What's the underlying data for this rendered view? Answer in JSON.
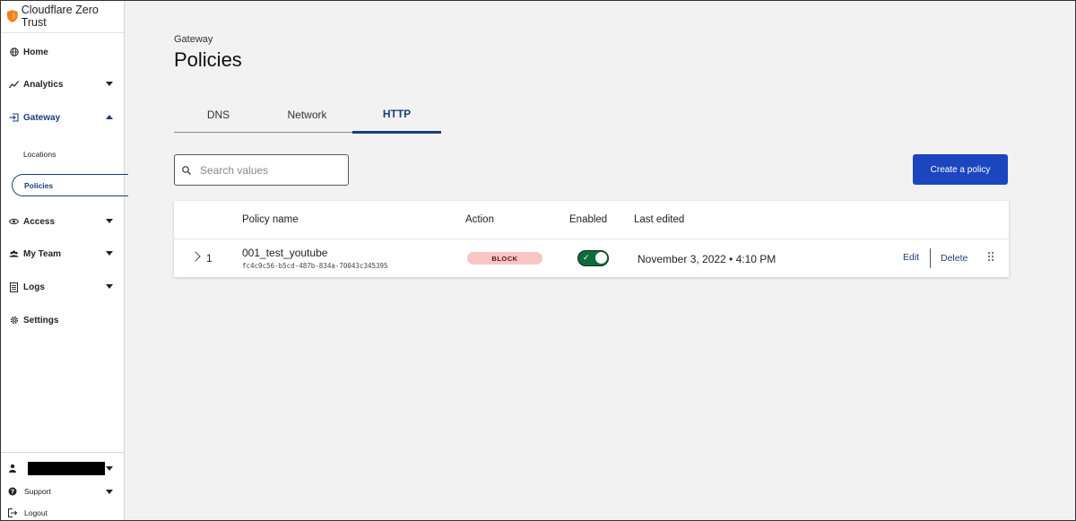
{
  "brand": {
    "name": "Cloudflare Zero Trust"
  },
  "sidebar": {
    "items": [
      {
        "label": "Home",
        "icon": "globe-icon"
      },
      {
        "label": "Analytics",
        "icon": "analytics-icon"
      },
      {
        "label": "Gateway",
        "icon": "gateway-icon"
      },
      {
        "label": "Access",
        "icon": "access-icon"
      },
      {
        "label": "My Team",
        "icon": "team-icon"
      },
      {
        "label": "Logs",
        "icon": "logs-icon"
      },
      {
        "label": "Settings",
        "icon": "gear-icon"
      }
    ],
    "gateway_sub": [
      {
        "label": "Locations"
      },
      {
        "label": "Policies"
      }
    ],
    "bottom": {
      "support": "Support",
      "logout": "Logout"
    }
  },
  "header": {
    "breadcrumb": "Gateway",
    "title": "Policies"
  },
  "tabs": [
    {
      "label": "DNS"
    },
    {
      "label": "Network"
    },
    {
      "label": "HTTP"
    }
  ],
  "search": {
    "placeholder": "Search values"
  },
  "actions": {
    "create_label": "Create a policy"
  },
  "table": {
    "headers": [
      "Policy name",
      "Action",
      "Enabled",
      "Last edited"
    ],
    "rows": [
      {
        "order": "1",
        "name": "001_test_youtube",
        "id": "fc4c9c56-b5cd-487b-834a-70043c345395",
        "action": "BLOCK",
        "enabled": true,
        "last_edited": "November 3, 2022 • 4:10 PM",
        "edit_label": "Edit",
        "delete_label": "Delete"
      }
    ]
  },
  "colors": {
    "accent": "#1d3d7a",
    "primary_button": "#1c46c0",
    "block_badge": "#f7c6c3",
    "toggle_on": "#0b6e3a",
    "brand_orange": "#f38020"
  }
}
